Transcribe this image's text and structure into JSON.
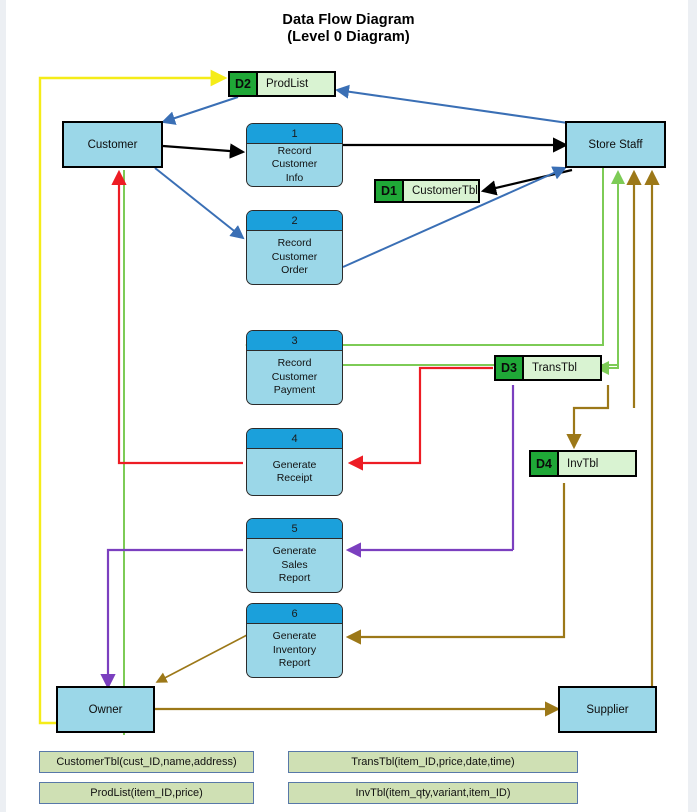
{
  "title": {
    "line1": "Data Flow Diagram",
    "line2": "(Level 0 Diagram)"
  },
  "entities": [
    {
      "id": "customer",
      "label": "Customer"
    },
    {
      "id": "storestaff",
      "label": "Store Staff"
    },
    {
      "id": "owner",
      "label": "Owner"
    },
    {
      "id": "supplier",
      "label": "Supplier"
    }
  ],
  "processes": [
    {
      "num": "1",
      "l1": "Record",
      "l2": "Customer",
      "l3": "Info"
    },
    {
      "num": "2",
      "l1": "Record",
      "l2": "Customer",
      "l3": "Order"
    },
    {
      "num": "3",
      "l1": "Record",
      "l2": "Customer",
      "l3": "Payment"
    },
    {
      "num": "4",
      "l1": "Generate",
      "l2": "Receipt",
      "l3": ""
    },
    {
      "num": "5",
      "l1": "Generate",
      "l2": "Sales",
      "l3": "Report"
    },
    {
      "num": "6",
      "l1": "Generate",
      "l2": "Inventory",
      "l3": "Report"
    }
  ],
  "stores": [
    {
      "tag": "D2",
      "name": "ProdList"
    },
    {
      "tag": "D1",
      "name": "CustomerTbl"
    },
    {
      "tag": "D3",
      "name": "TransTbl"
    },
    {
      "tag": "D4",
      "name": "InvTbl"
    }
  ],
  "legend": [
    {
      "text": "CustomerTbl(cust_ID,name,address)"
    },
    {
      "text": "TransTbl(item_ID,price,date,time)"
    },
    {
      "text": "ProdList(item_ID,price)"
    },
    {
      "text": "InvTbl(item_qty,variant,item_ID)"
    }
  ],
  "colors": {
    "entity_fill": "#9BD7E8",
    "process_header": "#1BA0DB",
    "process_body": "#9BD7E8",
    "store_tag": "#1FA837",
    "store_body": "#D9F3D2",
    "legend_fill": "#CFE0B4",
    "flow_black": "#000000",
    "flow_blue": "#3A6FB5",
    "flow_yellow": "#F5EC18",
    "flow_green": "#7DCB56",
    "flow_red": "#ED1C24",
    "flow_purple": "#7B3FBF",
    "flow_gold": "#9C7818"
  }
}
